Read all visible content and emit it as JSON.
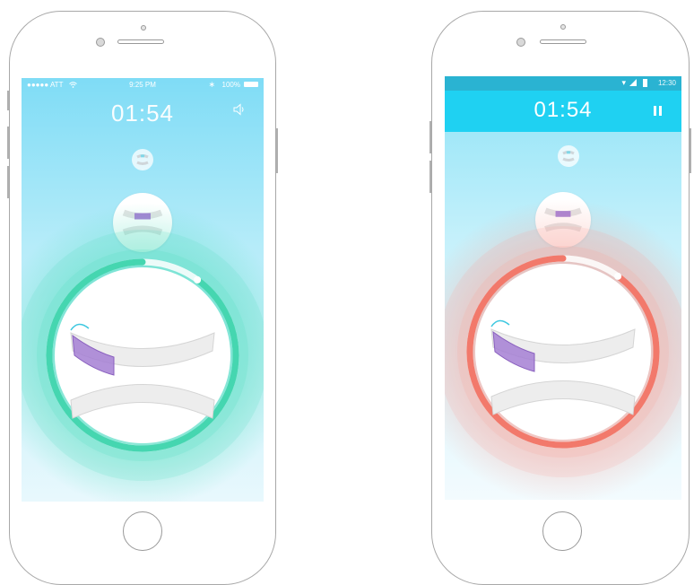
{
  "ios_screen": {
    "carrier": "●●●●● ATT",
    "time": "9:25 PM",
    "battery_text": "100%",
    "bluetooth_icon": "bluetooth-icon",
    "wifi_icon": "wifi-icon",
    "timer": "01:54",
    "sound_icon": "speaker-icon",
    "progress_fraction": 0.9,
    "ring_color": "#45d6b0",
    "highlight_color": "#a57fd3"
  },
  "android_screen": {
    "clock": "12:30",
    "wifi_icon": "wifi-icon",
    "signal_icon": "signal-icon",
    "battery_icon": "battery-icon",
    "timer": "01:54",
    "pause_icon": "pause-icon",
    "progress_fraction": 0.9,
    "ring_color": "#f2796b",
    "toolbar_color": "#1fd1f2",
    "highlight_color": "#a57fd3"
  }
}
